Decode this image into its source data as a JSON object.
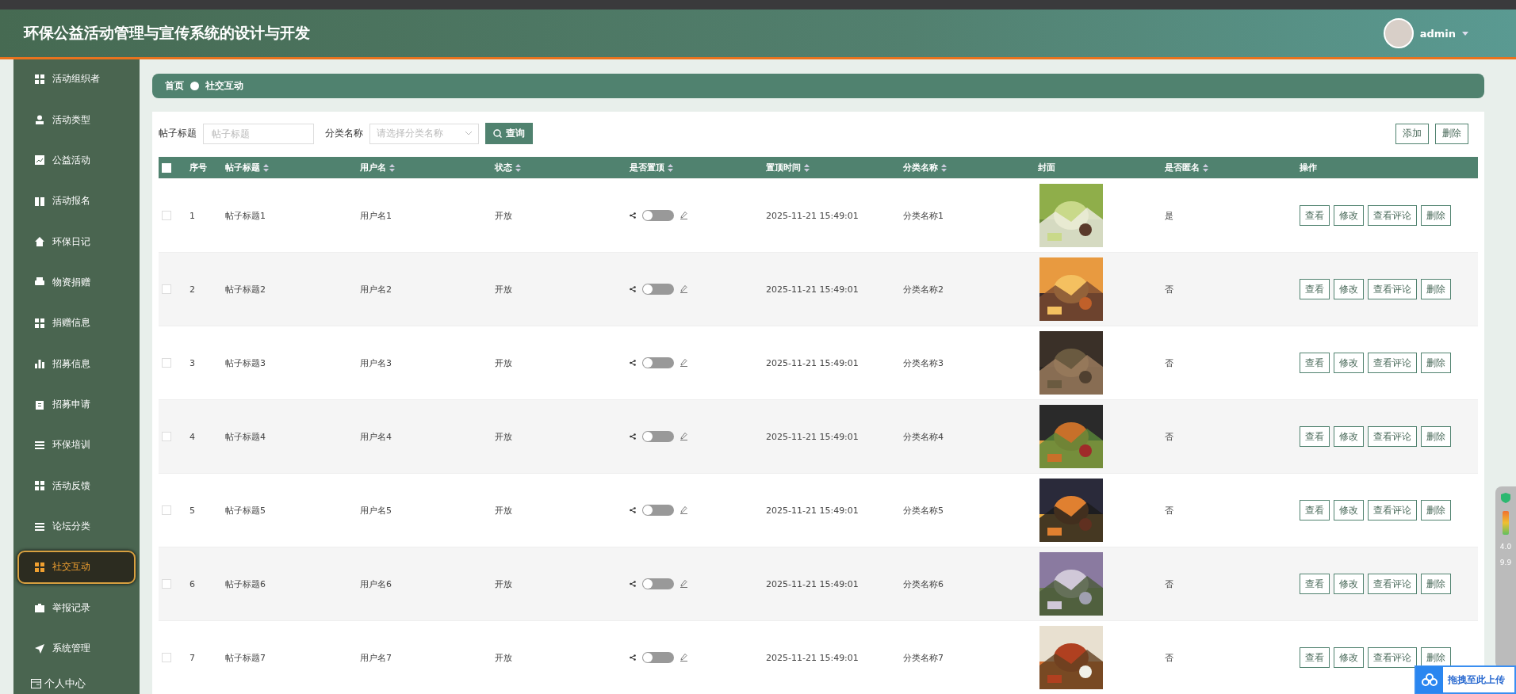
{
  "header": {
    "title": "环保公益活动管理与宣传系统的设计与开发",
    "user": "admin"
  },
  "sidebar": {
    "items": [
      {
        "label": "活动组织者",
        "selected": false
      },
      {
        "label": "活动类型",
        "selected": false
      },
      {
        "label": "公益活动",
        "selected": false
      },
      {
        "label": "活动报名",
        "selected": false
      },
      {
        "label": "环保日记",
        "selected": false
      },
      {
        "label": "物资捐赠",
        "selected": false
      },
      {
        "label": "捐赠信息",
        "selected": false
      },
      {
        "label": "招募信息",
        "selected": false
      },
      {
        "label": "招募申请",
        "selected": false
      },
      {
        "label": "环保培训",
        "selected": false
      },
      {
        "label": "活动反馈",
        "selected": false
      },
      {
        "label": "论坛分类",
        "selected": false
      },
      {
        "label": "社交互动",
        "selected": true
      },
      {
        "label": "举报记录",
        "selected": false
      },
      {
        "label": "系统管理",
        "selected": false
      }
    ],
    "footer_item": "个人中心"
  },
  "breadcrumb": [
    "首页",
    "社交互动"
  ],
  "search": {
    "title_label": "帖子标题",
    "title_placeholder": "帖子标题",
    "category_label": "分类名称",
    "category_placeholder": "请选择分类名称",
    "query_button": "查询"
  },
  "toolbar": [
    "添加",
    "删除"
  ],
  "table": {
    "all_checked": false,
    "columns": [
      {
        "label": "序号",
        "sortable": false
      },
      {
        "label": "帖子标题",
        "sortable": true
      },
      {
        "label": "用户名",
        "sortable": true
      },
      {
        "label": "状态",
        "sortable": true
      },
      {
        "label": "是否置顶",
        "sortable": true
      },
      {
        "label": "置顶时间",
        "sortable": true
      },
      {
        "label": "分类名称",
        "sortable": true
      },
      {
        "label": "封面",
        "sortable": false
      },
      {
        "label": "是否匿名",
        "sortable": true
      },
      {
        "label": "操作",
        "sortable": false
      }
    ],
    "rows": [
      {
        "index": "1",
        "title": "帖子标题1",
        "user": "用户名1",
        "status": "开放",
        "pinned": false,
        "time": "2025-11-21 15:49:01",
        "category": "分类名称1",
        "anonymous": "是",
        "checked": false,
        "actions": [
          "查看",
          "修改",
          "查看评论",
          "删除"
        ]
      },
      {
        "index": "2",
        "title": "帖子标题2",
        "user": "用户名2",
        "status": "开放",
        "pinned": false,
        "time": "2025-11-21 15:49:01",
        "category": "分类名称2",
        "anonymous": "否",
        "checked": false,
        "actions": [
          "查看",
          "修改",
          "查看评论",
          "删除"
        ]
      },
      {
        "index": "3",
        "title": "帖子标题3",
        "user": "用户名3",
        "status": "开放",
        "pinned": false,
        "time": "2025-11-21 15:49:01",
        "category": "分类名称3",
        "anonymous": "否",
        "checked": false,
        "actions": [
          "查看",
          "修改",
          "查看评论",
          "删除"
        ]
      },
      {
        "index": "4",
        "title": "帖子标题4",
        "user": "用户名4",
        "status": "开放",
        "pinned": false,
        "time": "2025-11-21 15:49:01",
        "category": "分类名称4",
        "anonymous": "否",
        "checked": false,
        "actions": [
          "查看",
          "修改",
          "查看评论",
          "删除"
        ]
      },
      {
        "index": "5",
        "title": "帖子标题5",
        "user": "用户名5",
        "status": "开放",
        "pinned": false,
        "time": "2025-11-21 15:49:01",
        "category": "分类名称5",
        "anonymous": "否",
        "checked": false,
        "actions": [
          "查看",
          "修改",
          "查看评论",
          "删除"
        ]
      },
      {
        "index": "6",
        "title": "帖子标题6",
        "user": "用户名6",
        "status": "开放",
        "pinned": false,
        "time": "2025-11-21 15:49:01",
        "category": "分类名称6",
        "anonymous": "否",
        "checked": false,
        "actions": [
          "查看",
          "修改",
          "查看评论",
          "删除"
        ]
      },
      {
        "index": "7",
        "title": "帖子标题7",
        "user": "用户名7",
        "status": "开放",
        "pinned": false,
        "time": "2025-11-21 15:49:01",
        "category": "分类名称7",
        "anonymous": "否",
        "checked": false,
        "actions": [
          "查看",
          "修改",
          "查看评论",
          "删除"
        ]
      }
    ]
  },
  "side_widget": {
    "up": "4.0",
    "down": "9.9"
  },
  "upload_button": "拖拽至此上传"
}
